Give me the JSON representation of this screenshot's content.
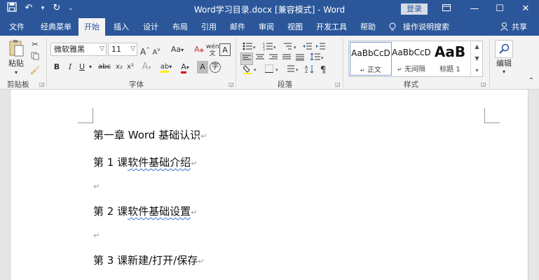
{
  "titlebar": {
    "title": "Word学习目录.docx [兼容模式] - Word",
    "login": "登录",
    "qat": {
      "save_icon": "save-icon",
      "undo_icon": "undo-icon",
      "redo_icon": "redo-icon"
    }
  },
  "tabs": [
    {
      "label": "文件"
    },
    {
      "label": "经典菜单"
    },
    {
      "label": "开始"
    },
    {
      "label": "插入"
    },
    {
      "label": "设计"
    },
    {
      "label": "布局"
    },
    {
      "label": "引用"
    },
    {
      "label": "邮件"
    },
    {
      "label": "审阅"
    },
    {
      "label": "视图"
    },
    {
      "label": "开发工具"
    },
    {
      "label": "帮助"
    },
    {
      "label": "操作说明搜索"
    },
    {
      "label": "共享"
    }
  ],
  "ribbon": {
    "clipboard": {
      "label": "剪贴板",
      "paste": "粘贴"
    },
    "font": {
      "label": "字体",
      "font_name": "微软雅黑",
      "font_size": "11",
      "bold": "B",
      "italic": "I",
      "underline": "U",
      "strike": "abc",
      "sub": "x₂",
      "sup": "x²",
      "grow": "A",
      "shrink": "A",
      "case": "Aa",
      "highlight": "ab",
      "color": "A",
      "char_border": "A",
      "phonetic": "wén",
      "enclose": "字"
    },
    "paragraph": {
      "label": "段落"
    },
    "styles": {
      "label": "样式",
      "items": [
        {
          "sample": "AaBbCcD",
          "name": "正文"
        },
        {
          "sample": "AaBbCcD",
          "name": "无间隔"
        },
        {
          "sample": "AaB",
          "name": "标题 1"
        }
      ]
    },
    "editing": {
      "label": "编辑"
    }
  },
  "document": {
    "paragraphs": [
      {
        "text": "第一章 Word 基础认识"
      },
      {
        "text": "第 1 课软件基础介绍",
        "lead": "第 1 课",
        "wavy": "软件基础介绍"
      },
      {
        "text": ""
      },
      {
        "text": "第 2 课软件基础设置",
        "lead": "第 2 课",
        "wavy": "软件基础设置"
      },
      {
        "text": ""
      },
      {
        "text": "第 3 课新建/打开/保存"
      }
    ],
    "para_mark": "↵"
  }
}
